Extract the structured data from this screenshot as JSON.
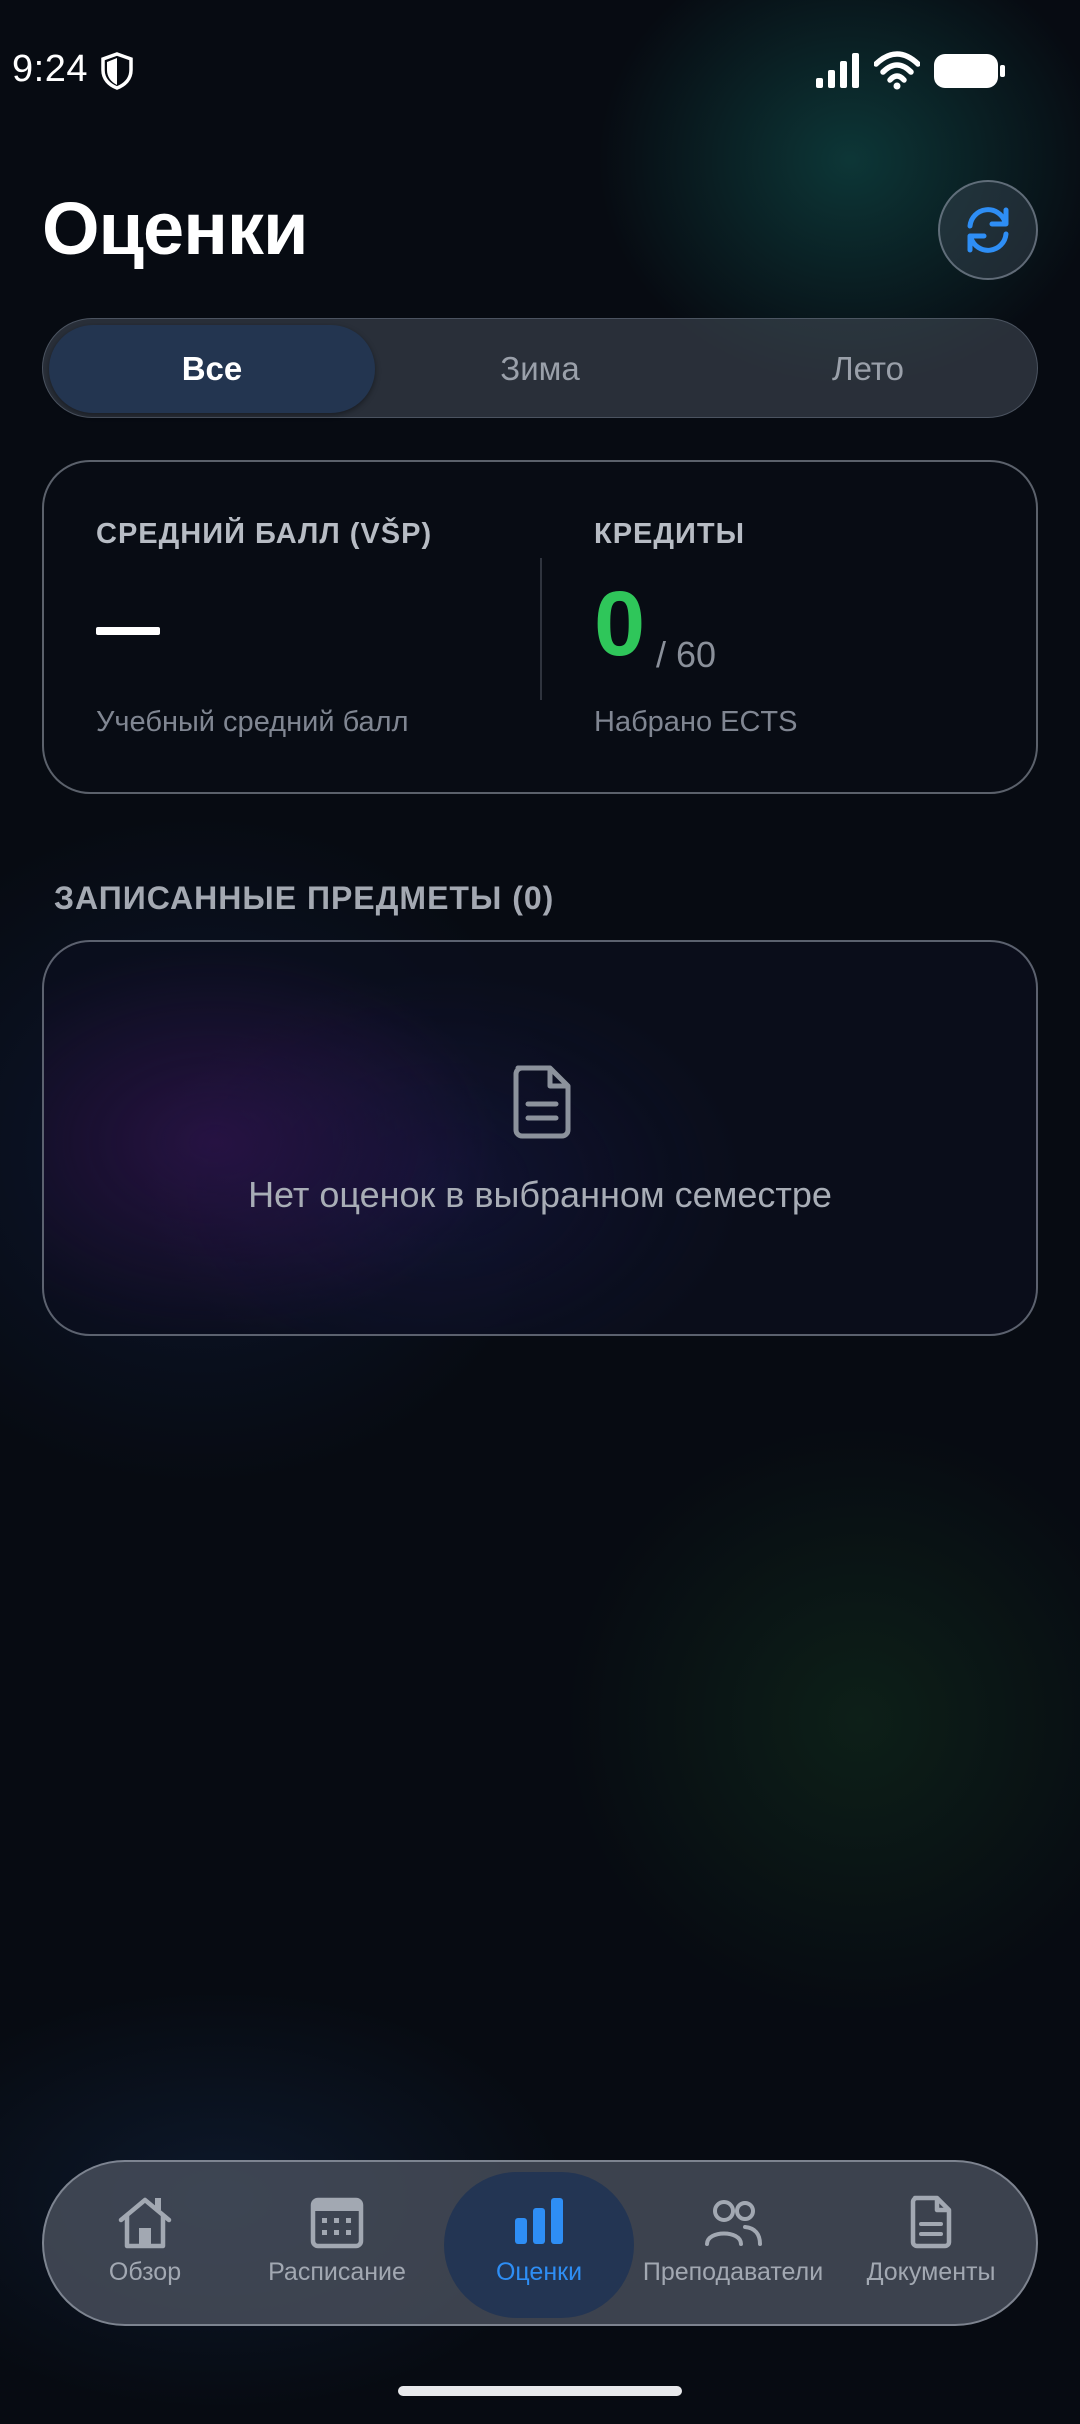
{
  "status_bar": {
    "time": "9:24"
  },
  "header": {
    "title": "Оценки"
  },
  "segments": [
    {
      "label": "Все",
      "active": true
    },
    {
      "label": "Зима",
      "active": false
    },
    {
      "label": "Лето",
      "active": false
    }
  ],
  "stats": {
    "gpa": {
      "label": "СРЕДНИЙ БАЛЛ (VŠP)",
      "value": "—",
      "sub": "Учебный средний балл"
    },
    "credits": {
      "label": "КРЕДИТЫ",
      "value": "0",
      "total": "/ 60",
      "sub": "Набрано ECTS"
    }
  },
  "subjects": {
    "title": "ЗАПИСАННЫЕ ПРЕДМЕТЫ (0)",
    "empty_text": "Нет оценок в выбранном семестре"
  },
  "tabs": [
    {
      "label": "Обзор",
      "icon": "home-icon"
    },
    {
      "label": "Расписание",
      "icon": "calendar-icon"
    },
    {
      "label": "Оценки",
      "icon": "bar-chart-icon",
      "active": true
    },
    {
      "label": "Преподаватели",
      "icon": "people-icon"
    },
    {
      "label": "Документы",
      "icon": "document-icon"
    }
  ],
  "colors": {
    "accent": "#2e8ef5",
    "credits": "#2fc65a",
    "active_segment": "#233550"
  }
}
